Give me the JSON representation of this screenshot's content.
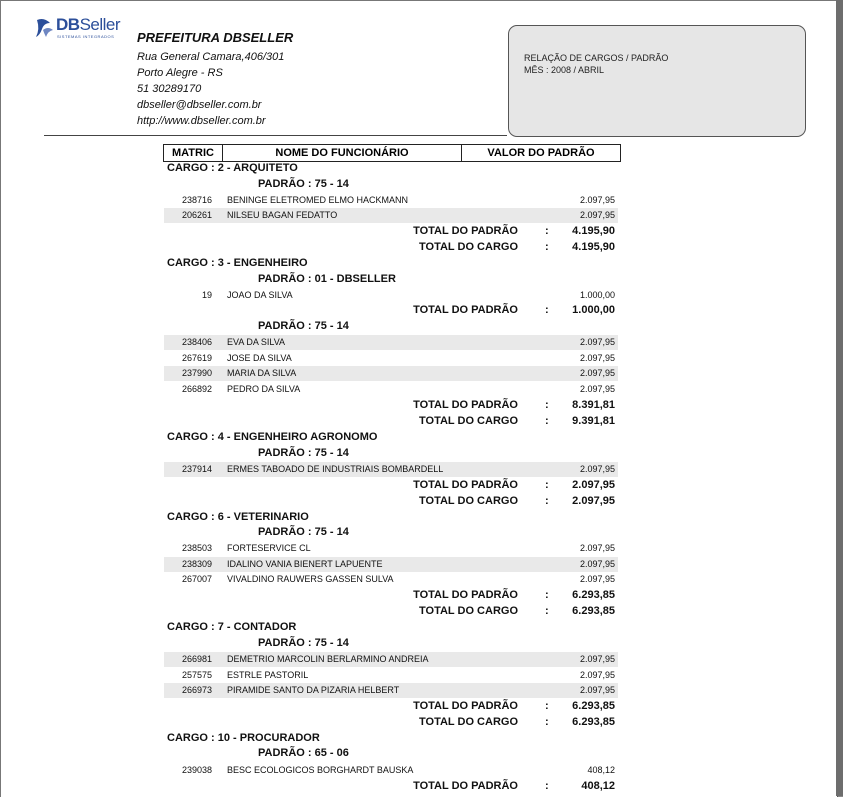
{
  "header": {
    "logo_text_bold": "DB",
    "logo_text_light": "Seller",
    "logo_tagline": "SISTEMAS INTEGRADOS",
    "org_name": "PREFEITURA DBSELLER",
    "address": "Rua General Camara,406/301",
    "city": "Porto Alegre - RS",
    "phone": "51 30289170",
    "email": "dbseller@dbseller.com.br",
    "website": "http://www.dbseller.com.br"
  },
  "report_box": {
    "title": "RELAÇÃO DE CARGOS / PADRÃO",
    "period": "MÊS  : 2008 / ABRIL"
  },
  "columns": {
    "matric": "MATRIC",
    "name": "NOME DO FUNCIONÁRIO",
    "value": "VALOR DO PADRÃO"
  },
  "labels": {
    "total_padrao": "TOTAL DO PADRÃO",
    "total_cargo": "TOTAL DO CARGO",
    "colon": ":"
  },
  "cargos": [
    {
      "title": "CARGO :  2 - ARQUITETO"
    },
    {
      "title": "CARGO :  3 - ENGENHEIRO"
    },
    {
      "title": "CARGO :  4 - ENGENHEIRO AGRONOMO"
    },
    {
      "title": "CARGO :  6 - VETERINARIO"
    },
    {
      "title": "CARGO :  7 - CONTADOR"
    },
    {
      "title": "CARGO :  10 - PROCURADOR"
    }
  ],
  "padroes": [
    {
      "title": "PADRÃO :  75 - 14",
      "total": "4.195,90"
    },
    {
      "title": "PADRÃO :  01 - DBSELLER",
      "total": "1.000,00"
    },
    {
      "title": "PADRÃO :  75 - 14",
      "total": "8.391,81"
    },
    {
      "title": "PADRÃO :  75 - 14",
      "total": "2.097,95"
    },
    {
      "title": "PADRÃO :  75 - 14",
      "total": "6.293,85"
    },
    {
      "title": "PADRÃO :  75 - 14",
      "total": "6.293,85"
    },
    {
      "title": "PADRÃO :  65 - 06",
      "total": "408,12"
    }
  ],
  "cargo_totals": [
    "4.195,90",
    "9.391,81",
    "2.097,95",
    "6.293,85",
    "6.293,85"
  ],
  "rows": [
    {
      "matric": "238716",
      "name": "BENINGE ELETROMED ELMO HACKMANN",
      "value": "2.097,95"
    },
    {
      "matric": "206261",
      "name": "NILSEU BAGAN FEDATTO",
      "value": "2.097,95"
    },
    {
      "matric": "19",
      "name": "JOAO DA SILVA",
      "value": "1.000,00"
    },
    {
      "matric": "238406",
      "name": "EVA DA SILVA",
      "value": "2.097,95"
    },
    {
      "matric": "267619",
      "name": "JOSE DA SILVA",
      "value": "2.097,95"
    },
    {
      "matric": "237990",
      "name": "MARIA DA SILVA",
      "value": "2.097,95"
    },
    {
      "matric": "266892",
      "name": "PEDRO DA SILVA",
      "value": "2.097,95"
    },
    {
      "matric": "237914",
      "name": "ERMES TABOADO DE INDUSTRIAIS BOMBARDELL",
      "value": "2.097,95"
    },
    {
      "matric": "238503",
      "name": "FORTESERVICE CL",
      "value": "2.097,95"
    },
    {
      "matric": "238309",
      "name": "IDALINO VANIA BIENERT LAPUENTE",
      "value": "2.097,95"
    },
    {
      "matric": "267007",
      "name": "VIVALDINO RAUWERS GASSEN SULVA",
      "value": "2.097,95"
    },
    {
      "matric": "266981",
      "name": "DEMETRIO MARCOLIN BERLARMINO ANDREIA",
      "value": "2.097,95"
    },
    {
      "matric": "257575",
      "name": "ESTRLE PASTORIL",
      "value": "2.097,95"
    },
    {
      "matric": "266973",
      "name": "PIRAMIDE SANTO DA PIZARIA HELBERT",
      "value": "2.097,95"
    },
    {
      "matric": "239038",
      "name": "BESC ECOLOGICOS BORGHARDT BAUSKA",
      "value": "408,12"
    }
  ]
}
